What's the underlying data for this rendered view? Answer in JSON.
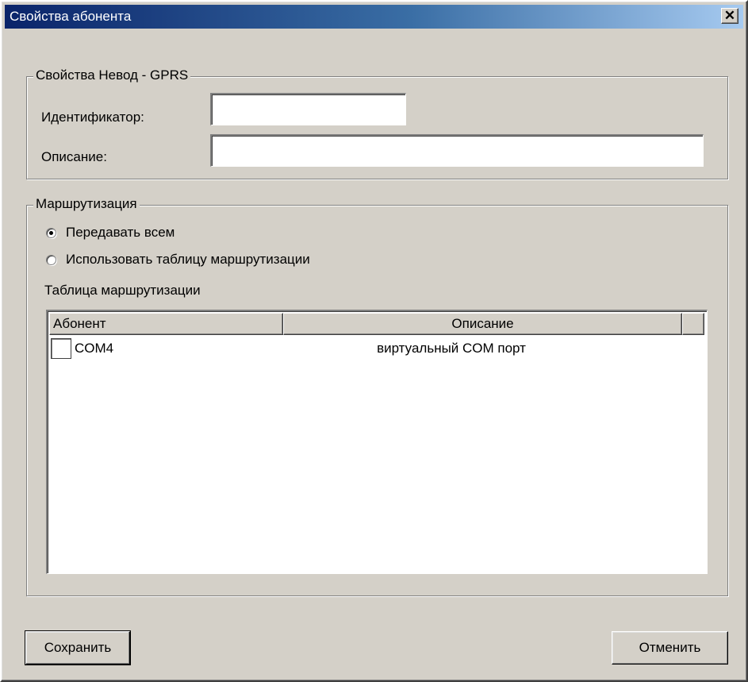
{
  "window": {
    "title": "Свойства абонента",
    "close_glyph": "✕"
  },
  "properties_group": {
    "legend": "Свойства Невод - GPRS",
    "identifier_label": "Идентификатор:",
    "identifier_value": "",
    "description_label": "Описание:",
    "description_value": ""
  },
  "routing_group": {
    "legend": "Маршрутизация",
    "radio_send_all": {
      "label": "Передавать всем",
      "checked": true
    },
    "radio_use_table": {
      "label": "Использовать таблицу маршрутизации",
      "checked": false
    },
    "table_label": "Таблица маршрутизации",
    "table": {
      "columns": [
        "Абонент",
        "Описание"
      ],
      "rows": [
        {
          "subscriber": "COM4",
          "description": "виртуальный COM порт",
          "checked": false
        }
      ]
    }
  },
  "buttons": {
    "save": "Сохранить",
    "cancel": "Отменить"
  },
  "colors": {
    "dialog_bg": "#d4d0c8",
    "titlebar_start": "#0a246a",
    "titlebar_end": "#a6caf0"
  }
}
